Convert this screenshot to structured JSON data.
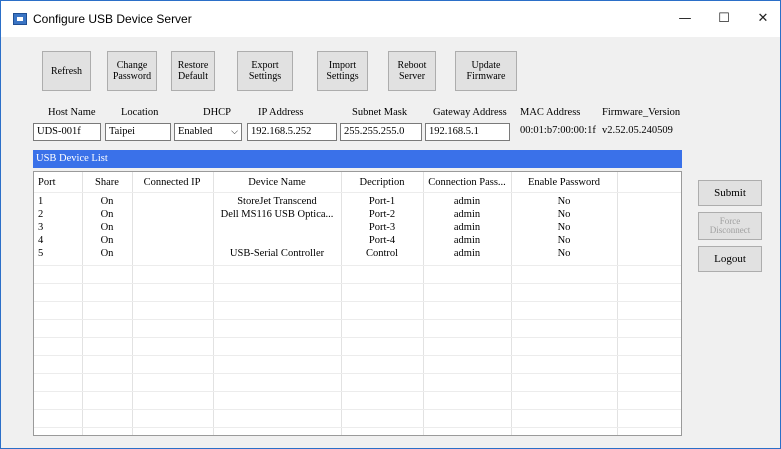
{
  "window": {
    "title": "Configure USB Device Server",
    "minimize": "—",
    "maximize": "☐",
    "close": "✕"
  },
  "toolbar": {
    "refresh": "Refresh",
    "change_password": "Change\nPassword",
    "restore_default": "Restore\nDefault",
    "export_settings": "Export\nSettings",
    "import_settings": "Import\nSettings",
    "reboot_server": "Reboot\nServer",
    "update_firmware": "Update\nFirmware"
  },
  "server": {
    "labels": {
      "host_name": "Host Name",
      "location": "Location",
      "dhcp": "DHCP",
      "ip_address": "IP Address",
      "subnet_mask": "Subnet Mask",
      "gateway_address": "Gateway Address",
      "mac_address": "MAC Address",
      "firmware_version": "Firmware_Version"
    },
    "values": {
      "host_name": "UDS-001f",
      "location": "Taipei",
      "dhcp": "Enabled",
      "ip_address": "192.168.5.252",
      "subnet_mask": "255.255.255.0",
      "gateway_address": "192.168.5.1",
      "mac_address": "00:01:b7:00:00:1f",
      "firmware_version": "v2.52.05.240509"
    }
  },
  "device_list": {
    "title": "USB Device List",
    "columns": [
      "Port",
      "Share",
      "Connected IP",
      "Device Name",
      "Decription",
      "Connection Pass...",
      "Enable Password"
    ],
    "rows": [
      [
        "1",
        "On",
        "",
        "StoreJet Transcend",
        "Port-1",
        "admin",
        "No"
      ],
      [
        "2",
        "On",
        "",
        "Dell MS116 USB Optica...",
        "Port-2",
        "admin",
        "No"
      ],
      [
        "3",
        "On",
        "",
        "",
        "Port-3",
        "admin",
        "No"
      ],
      [
        "4",
        "On",
        "",
        "",
        "Port-4",
        "admin",
        "No"
      ],
      [
        "5",
        "On",
        "",
        "USB-Serial Controller",
        "Control",
        "admin",
        "No"
      ]
    ]
  },
  "side": {
    "submit": "Submit",
    "force_disconnect": "Force\nDisconnect",
    "logout": "Logout"
  }
}
